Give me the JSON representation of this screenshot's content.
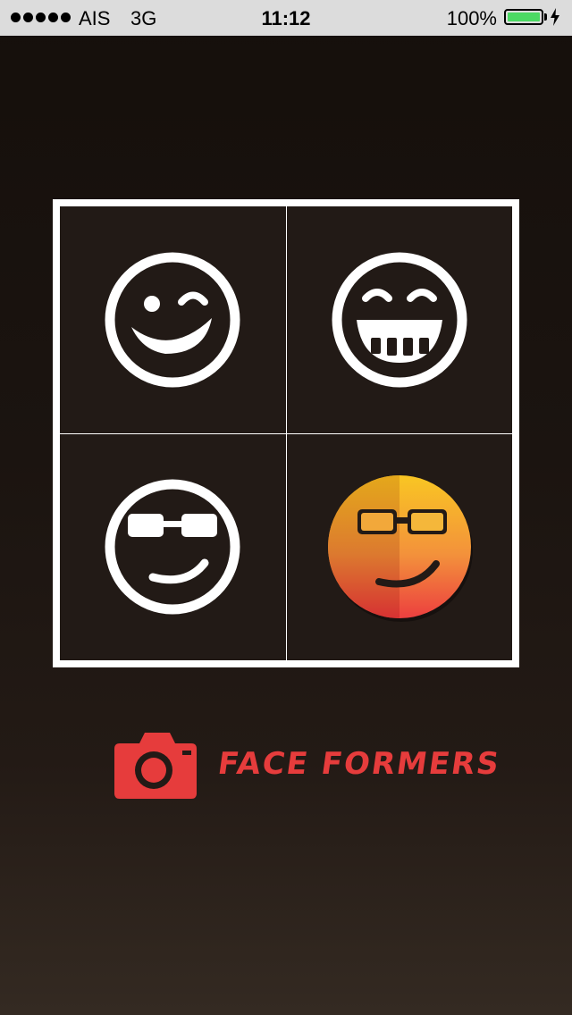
{
  "status_bar": {
    "carrier": "AIS",
    "network": "3G",
    "time": "11:12",
    "battery_percent": "100%",
    "battery_level": 1.0,
    "signal_bars": 5,
    "charging_icon": "lightning-bolt-icon"
  },
  "grid": {
    "cells": [
      {
        "icon": "wink-face-icon"
      },
      {
        "icon": "grin-face-icon"
      },
      {
        "icon": "sunglasses-face-icon"
      },
      {
        "icon": "sunglasses-face-color-icon"
      }
    ]
  },
  "brand": {
    "camera_icon": "camera-icon",
    "title": "FACE FORMERS",
    "accent_color": "#e63c3c"
  },
  "colors": {
    "background": "#1b1410",
    "cell_background": "#221a16",
    "icon_white": "#ffffff",
    "gradient_top": "#f9c623",
    "gradient_bottom": "#ec3f3f",
    "status_bar_bg": "#dcdcdc",
    "battery_green": "#4cd964"
  }
}
